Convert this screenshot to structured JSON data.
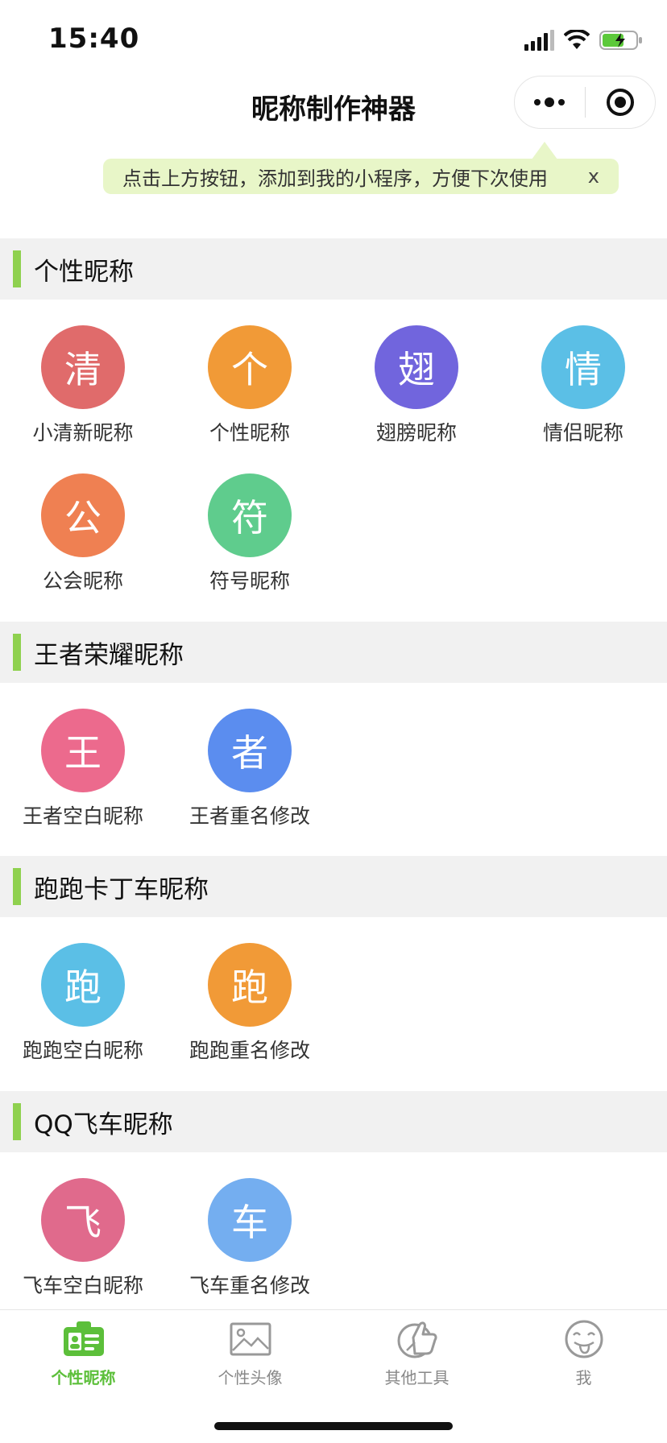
{
  "status_bar": {
    "time": "15:40"
  },
  "nav": {
    "title": "昵称制作神器"
  },
  "tip": {
    "text": "点击上方按钮，添加到我的小程序，方便下次使用",
    "close": "x"
  },
  "sections": [
    {
      "title": "个性昵称",
      "items": [
        {
          "char": "清",
          "label": "小清新昵称",
          "color": "#e06b6b"
        },
        {
          "char": "个",
          "label": "个性昵称",
          "color": "#f19a37"
        },
        {
          "char": "翅",
          "label": "翅膀昵称",
          "color": "#7165dd"
        },
        {
          "char": "情",
          "label": "情侣昵称",
          "color": "#5bbfe6"
        },
        {
          "char": "公",
          "label": "公会昵称",
          "color": "#ef8052"
        },
        {
          "char": "符",
          "label": "符号昵称",
          "color": "#5fcc8d"
        }
      ]
    },
    {
      "title": "王者荣耀昵称",
      "items": [
        {
          "char": "王",
          "label": "王者空白昵称",
          "color": "#ec6a8d"
        },
        {
          "char": "者",
          "label": "王者重名修改",
          "color": "#5b8def"
        }
      ]
    },
    {
      "title": "跑跑卡丁车昵称",
      "items": [
        {
          "char": "跑",
          "label": "跑跑空白昵称",
          "color": "#5bbfe6"
        },
        {
          "char": "跑",
          "label": "跑跑重名修改",
          "color": "#f19a37"
        }
      ]
    },
    {
      "title": "QQ飞车昵称",
      "items": [
        {
          "char": "飞",
          "label": "飞车空白昵称",
          "color": "#e06a8c"
        },
        {
          "char": "车",
          "label": "飞车重名修改",
          "color": "#74aef0"
        }
      ]
    }
  ],
  "tabs": [
    {
      "label": "个性昵称",
      "icon": "id-card-icon",
      "active": true
    },
    {
      "label": "个性头像",
      "icon": "image-icon",
      "active": false
    },
    {
      "label": "其他工具",
      "icon": "thumbs-up-icon",
      "active": false
    },
    {
      "label": "我",
      "icon": "tongue-face-icon",
      "active": false
    }
  ],
  "colors": {
    "accent": "#5cbf3a",
    "section_bar": "#8fd14f",
    "tip_bg": "#e8f6c8"
  }
}
